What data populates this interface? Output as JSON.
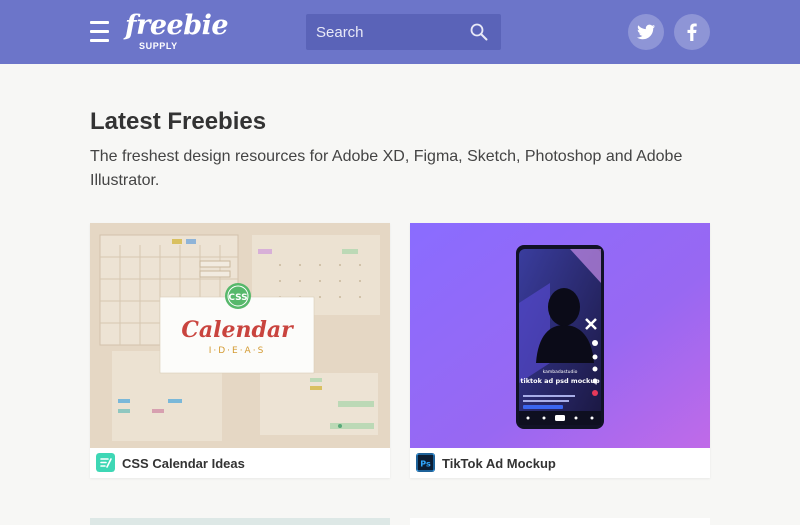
{
  "header": {
    "logo_text": "freebie",
    "logo_sub": "SUPPLY",
    "search_placeholder": "Search",
    "menu_icon": "hamburger-icon",
    "search_icon": "search-icon",
    "social": [
      "twitter-icon",
      "facebook-icon"
    ],
    "colors": {
      "bar": "#6c75c9",
      "search_bg": "#5a63b8",
      "social_bg": "#8e95d6"
    }
  },
  "main": {
    "title": "Latest Freebies",
    "subtitle": "The freshest design resources for Adobe XD, Figma, Sketch, Photoshop and Adobe Illustrator.",
    "cards": [
      {
        "title": "CSS Calendar Ideas",
        "badge_icon": "code-badge-icon",
        "badge_color": "#3ed7b5",
        "thumb": {
          "headline": "Calendar",
          "subline": "I·D·E·A·S",
          "tag": "CSS"
        }
      },
      {
        "title": "TikTok Ad Mockup",
        "badge_icon": "photoshop-badge-icon",
        "badge_label": "Ps",
        "badge_color": "#0b1d33",
        "thumb": {
          "phone_title": "tiktok ad psd mockup",
          "username": "kambadastudio"
        }
      }
    ]
  }
}
